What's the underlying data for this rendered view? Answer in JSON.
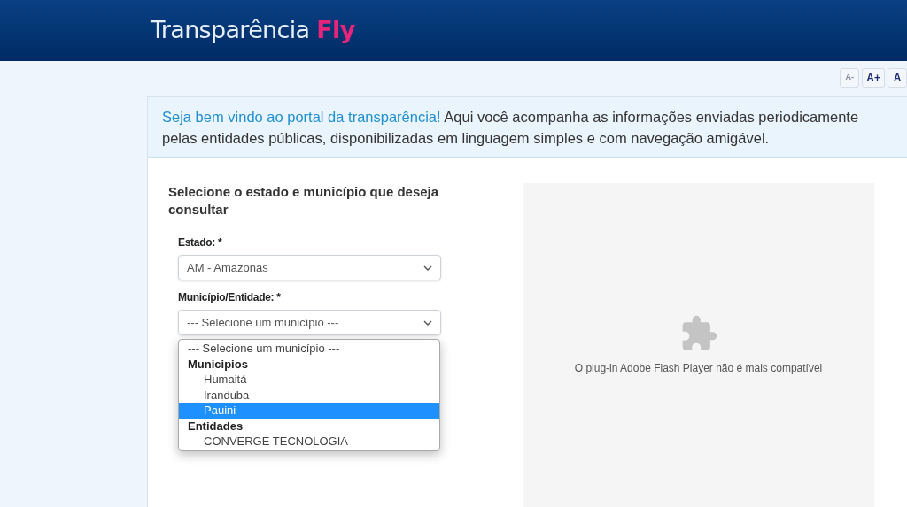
{
  "header": {
    "brand": "Transparência",
    "accent": "Fly"
  },
  "font_buttons": [
    {
      "label": "A-",
      "disabled": true
    },
    {
      "label": "A+",
      "disabled": false
    },
    {
      "label": "A",
      "disabled": false
    }
  ],
  "welcome": {
    "highlight": "Seja bem vindo ao portal da transparência!",
    "text": "Aqui você acompanha as informações enviadas periodicamente pelas entidades públicas, disponibilizadas em linguagem simples e com navegação amigável."
  },
  "form": {
    "title": "Selecione o estado e município que deseja consultar",
    "fields": [
      {
        "label": "Estado: *",
        "value": "AM - Amazonas"
      },
      {
        "label": "Município/Entidade: *",
        "value": "--- Selecione um município ---"
      }
    ],
    "dropdown": [
      {
        "kind": "placeholder",
        "label": "--- Selecione um município ---",
        "selected": false
      },
      {
        "kind": "group",
        "label": "Municipios"
      },
      {
        "kind": "option",
        "label": "Humaitá",
        "selected": false
      },
      {
        "kind": "option",
        "label": "Iranduba",
        "selected": false
      },
      {
        "kind": "option",
        "label": "Pauini",
        "selected": true
      },
      {
        "kind": "group",
        "label": "Entidades"
      },
      {
        "kind": "option",
        "label": "CONVERGE TECNOLOGIA",
        "selected": false
      }
    ]
  },
  "plugin": {
    "message": "O plug-in Adobe Flash Player não é mais compatível"
  }
}
